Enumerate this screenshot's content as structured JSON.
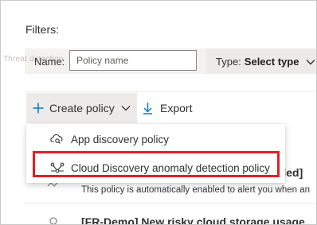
{
  "filters": {
    "heading": "Filters:",
    "ghost_text": "Threat detection",
    "name_label": "Name:",
    "name_placeholder": "Policy name",
    "type_label": "Type:",
    "type_value": "Select type"
  },
  "toolbar": {
    "create_label": "Create policy",
    "export_label": "Export"
  },
  "menu": {
    "items": [
      {
        "label": "App discovery policy",
        "icon": "cloud-search-icon"
      },
      {
        "label": "Cloud Discovery anomaly detection policy",
        "icon": "anomaly-icon",
        "highlighted": true
      }
    ]
  },
  "policies": [
    {
      "title": "abled]",
      "description": "This policy is automatically enabled to alert you when an"
    },
    {
      "title": "[FR-Demo] New risky cloud storage usage"
    }
  ],
  "colors": {
    "highlight": "#e01f26",
    "accent": "#0078d4"
  }
}
